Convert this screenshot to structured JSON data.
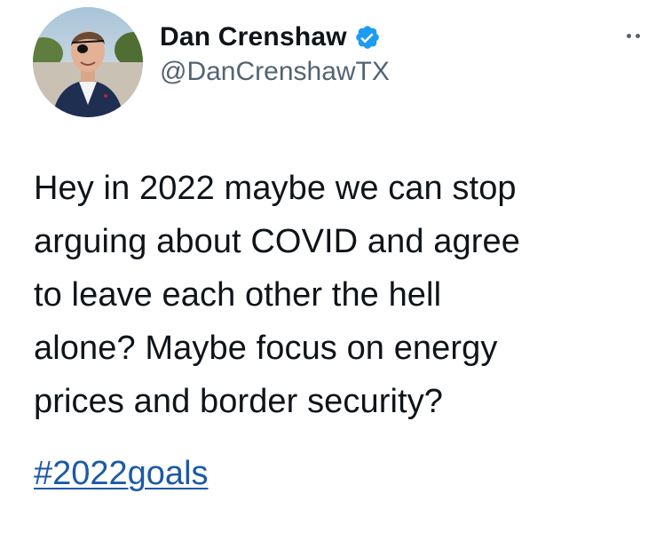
{
  "author": {
    "display_name": "Dan Crenshaw",
    "handle": "@DanCrenshawTX",
    "verified": true,
    "verified_color": "#1d9bf0"
  },
  "tweet": {
    "lines": [
      "Hey in 2022 maybe we can stop",
      "arguing about COVID and agree",
      "to leave each other the hell",
      "alone? Maybe focus on energy",
      "prices and border security?"
    ],
    "hashtag": "#2022goals",
    "hashtag_color": "#1b5aa6"
  },
  "icons": {
    "avatar": "profile-photo",
    "verified": "verified-badge-icon",
    "more": "more-options-icon"
  }
}
